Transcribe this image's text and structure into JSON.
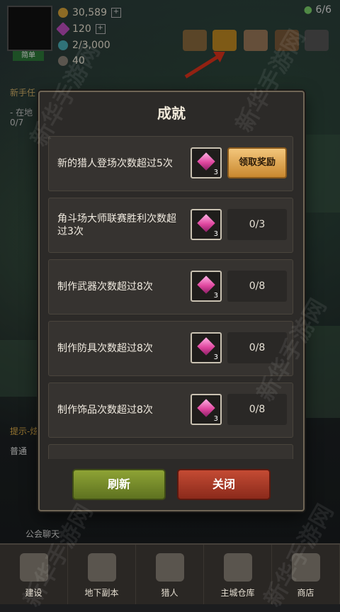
{
  "hud": {
    "level_badge": "简单",
    "gold": "30,589",
    "gems": "120",
    "stamina": "2/3,000",
    "time": "40",
    "hunters": "6/6"
  },
  "left_panel": {
    "quest_label": "新手任",
    "quest_line1": "- 在地",
    "quest_line2": "0/7",
    "hint": "提示-炫",
    "chat_channel": "普通",
    "chat_label": "公会聊天"
  },
  "modal": {
    "title": "成就",
    "items": [
      {
        "text": "新的猎人登场次数超过5次",
        "reward_qty": "3",
        "status": "领取奖励",
        "claimable": true
      },
      {
        "text": "角斗场大师联赛胜利次数超过3次",
        "reward_qty": "3",
        "status": "0/3",
        "claimable": false
      },
      {
        "text": "制作武器次数超过8次",
        "reward_qty": "3",
        "status": "0/8",
        "claimable": false
      },
      {
        "text": "制作防具次数超过8次",
        "reward_qty": "3",
        "status": "0/8",
        "claimable": false
      },
      {
        "text": "制作饰品次数超过8次",
        "reward_qty": "3",
        "status": "0/8",
        "claimable": false
      }
    ],
    "refresh_label": "刷新",
    "close_label": "关闭"
  },
  "nav": [
    {
      "label": "建设"
    },
    {
      "label": "地下副本"
    },
    {
      "label": "猎人"
    },
    {
      "label": "主城仓库"
    },
    {
      "label": "商店"
    }
  ],
  "watermark": "新华手游网",
  "colors": {
    "claim": "#e0a24e",
    "refresh": "#7a8f2b",
    "close": "#b13e29",
    "arrow": "#e0331c"
  }
}
